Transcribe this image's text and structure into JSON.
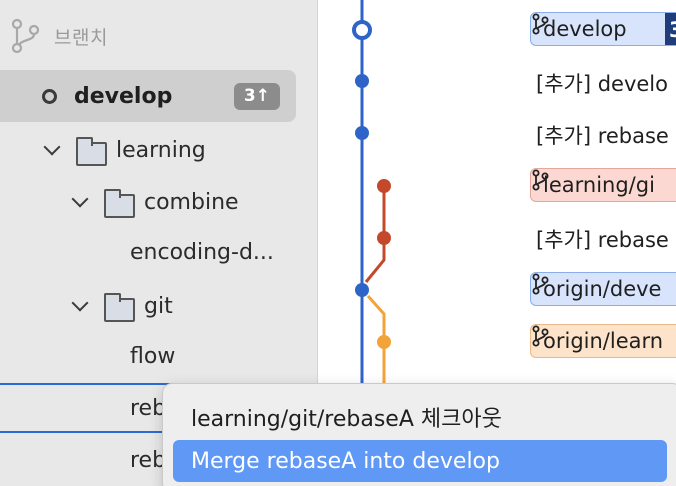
{
  "sidebar": {
    "header_label": "브랜치",
    "current_branch": {
      "name": "develop",
      "badge": "3↑"
    },
    "tree": [
      {
        "label": "learning"
      },
      {
        "label": "combine"
      },
      {
        "label": "encoding-d..."
      },
      {
        "label": "git"
      },
      {
        "label": "flow"
      },
      {
        "label": "reb"
      },
      {
        "label": "reb"
      }
    ]
  },
  "graph": {
    "rows": [
      {
        "type": "tag",
        "label": "develop",
        "count": "3"
      },
      {
        "type": "msg",
        "label": "[추가] develo"
      },
      {
        "type": "msg",
        "label": "[추가] rebase"
      },
      {
        "type": "tag",
        "label": "learning/gi"
      },
      {
        "type": "msg",
        "label": "[추가] rebase"
      },
      {
        "type": "tag",
        "label": "origin/deve"
      },
      {
        "type": "tag",
        "label": "origin/learn"
      }
    ],
    "colors": {
      "main": "#2e64c8",
      "branch": "#c4482a",
      "origin": "#f2a33a"
    }
  },
  "context_menu": {
    "items": [
      {
        "label": "learning/git/rebaseA 체크아웃"
      },
      {
        "label": "Merge rebaseA into develop"
      }
    ]
  }
}
